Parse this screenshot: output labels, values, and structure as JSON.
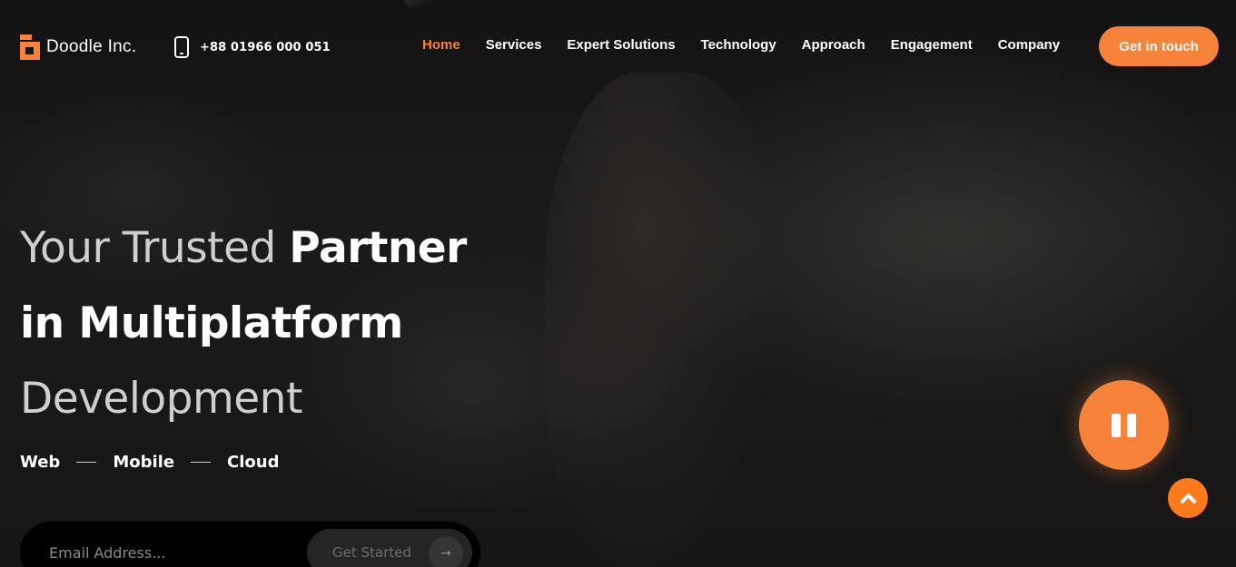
{
  "brand": {
    "name": "Doodle Inc.",
    "accent": "#f7823a"
  },
  "contact": {
    "phone": "+88 01966 000 051"
  },
  "nav": {
    "items": [
      {
        "label": "Home",
        "active": true
      },
      {
        "label": "Services"
      },
      {
        "label": "Expert Solutions"
      },
      {
        "label": "Technology"
      },
      {
        "label": "Approach"
      },
      {
        "label": "Engagement"
      },
      {
        "label": "Company"
      }
    ],
    "cta_label": "Get in touch"
  },
  "hero": {
    "line1_light": "Your Trusted ",
    "line1_bold": "Partner",
    "line2_bold": "in Multiplatform",
    "line3_light": "Development",
    "tags": [
      "Web",
      "Mobile",
      "Cloud"
    ]
  },
  "signup": {
    "email_placeholder": "Email Address...",
    "button_label": "Get Started",
    "arrow_icon": "arrow-right-icon"
  },
  "controls": {
    "pause_icon": "pause-icon",
    "scroll_top_icon": "chevron-up-icon"
  }
}
